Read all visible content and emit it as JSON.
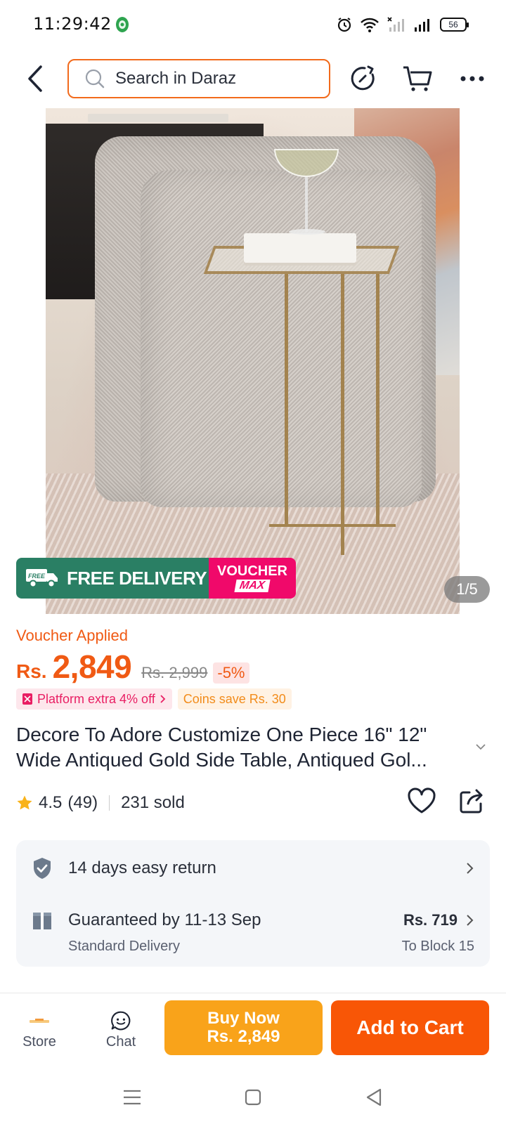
{
  "status_bar": {
    "time": "11:29:42",
    "battery": "56"
  },
  "header": {
    "search_placeholder": "Search in Daraz"
  },
  "product_image": {
    "counter": "1/5"
  },
  "promo_badge": {
    "free_delivery": "FREE DELIVERY",
    "free_small": "FREE",
    "voucher_top": "VOUCHER",
    "voucher_bottom": "MAX"
  },
  "pricing": {
    "voucher_applied": "Voucher Applied",
    "currency": "Rs.",
    "price": "2,849",
    "original_price": "Rs. 2,999",
    "discount": "-5%",
    "platform_tag": "Platform extra 4% off",
    "coins_tag": "Coins save Rs. 30"
  },
  "product": {
    "title": "Decore To Adore Customize One Piece 16\" 12\" Wide Antiqued Gold Side Table, Antiqued Gol...",
    "rating": "4.5",
    "review_count": "(49)",
    "sold": "231 sold"
  },
  "services": {
    "return_label": "14 days easy return",
    "delivery_label": "Guaranteed by 11-13 Sep",
    "delivery_type": "Standard Delivery",
    "delivery_fee": "Rs. 719",
    "delivery_location": "To Block 15"
  },
  "bottom_bar": {
    "store_label": "Store",
    "chat_label": "Chat",
    "buy_now_label": "Buy Now",
    "buy_now_price": "Rs. 2,849",
    "add_to_cart_label": "Add to Cart"
  },
  "colors": {
    "brand_orange": "#f85606",
    "buy_now": "#f9a31a",
    "free_delivery_green": "#2a7f64",
    "voucher_pink": "#f0096a"
  }
}
